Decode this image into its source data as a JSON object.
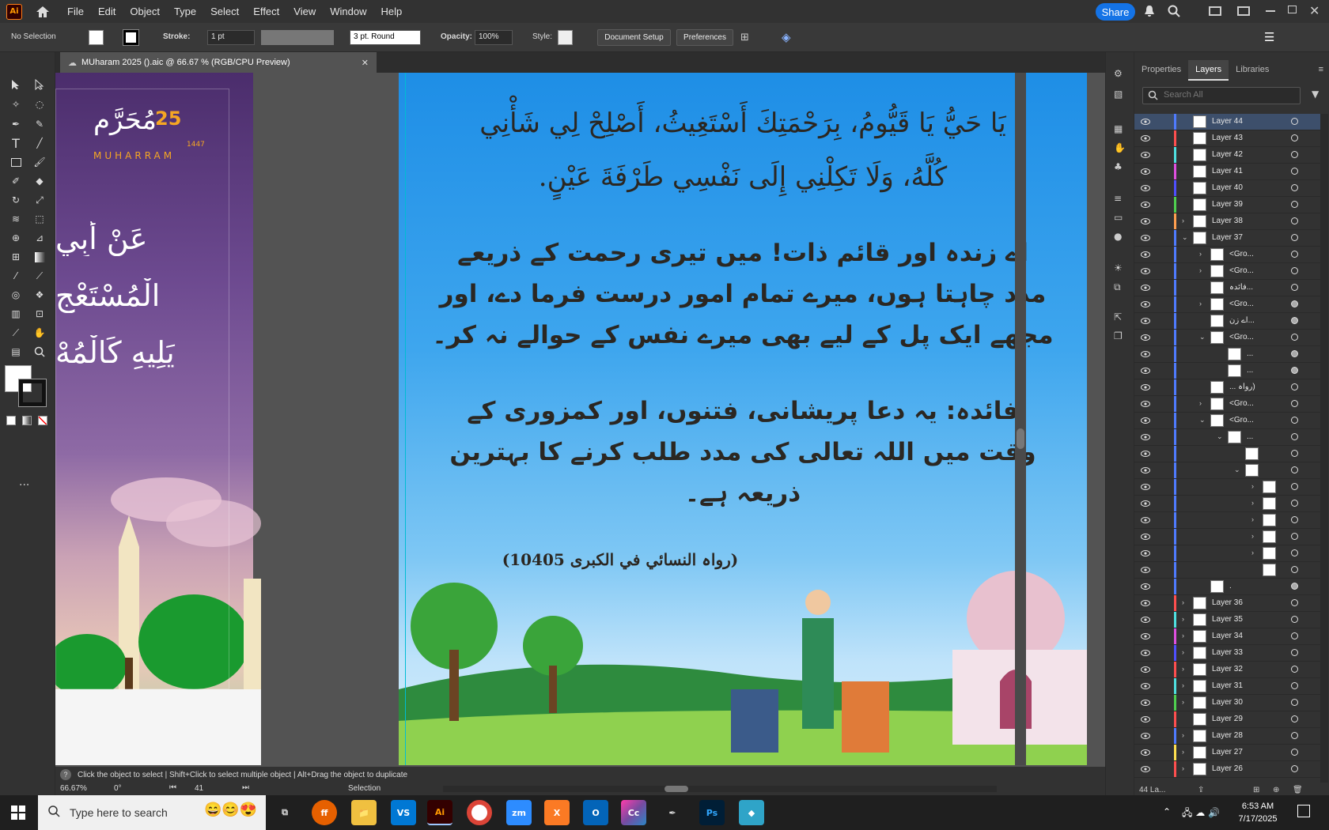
{
  "app": {
    "logo": "Ai",
    "share_label": "Share"
  },
  "menu": [
    "File",
    "Edit",
    "Object",
    "Type",
    "Select",
    "Effect",
    "View",
    "Window",
    "Help"
  ],
  "control": {
    "selection": "No Selection",
    "stroke_label": "Stroke:",
    "stroke_value": "1 pt",
    "brush_value": "3 pt. Round",
    "opacity_label": "Opacity:",
    "opacity_value": "100%",
    "style_label": "Style:",
    "document_setup": "Document Setup",
    "preferences": "Preferences"
  },
  "document": {
    "tab_title": "MUharam 2025 ().aic @ 66.67 % (RGB/CPU Preview)"
  },
  "artboard_left": {
    "date_number": "25",
    "month_arabic": "مُحَرَّم",
    "month_latin": "MUHARRAM",
    "year_small": "1447",
    "line1": "عَنْ أَبِي",
    "line2": "الْمُسْتَعْجِ",
    "line3": "يَلِيهِ كَالْمُهْ"
  },
  "artboard_main": {
    "dua_line1": "يَا حَيُّ يَا قَيُّومُ، بِرَحْمَتِكَ أَسْتَغِيثُ، أَصْلِحْ لِي شَأْنِي",
    "dua_line2": "كُلَّهُ، وَلَا تَكِلْنِي إِلَى نَفْسِي طَرْفَةَ عَيْنٍ.",
    "urdu_line1": "اے زندہ اور قائم ذات! میں تیری رحمت کے ذریعے",
    "urdu_line2": "مدد چاہتا ہوں، میرے تمام امور درست فرما دے، اور",
    "urdu_line3": "مجھے ایک پل کے لیے بھی میرے نفس کے حوالے نہ کر۔",
    "benefit_line1": "فائدہ: یہ دعا پریشانی، فتنوں، اور کمزوری کے",
    "benefit_line2": "وقت میں اللہ تعالی کی مدد طلب کرنے کا بہترین",
    "benefit_line3": "ذریعہ ہے۔",
    "reference": "(رواہ النسائي في الكبرى 10405)"
  },
  "layers_panel": {
    "tabs": [
      "Properties",
      "Layers",
      "Libraries"
    ],
    "active_tab": "Layers",
    "search_placeholder": "Search All",
    "footer_count": "44 La...",
    "rows": [
      {
        "name": "Layer 44",
        "color": "#4f7bff",
        "indent": 0,
        "twirl": "",
        "selected": true,
        "filled": false
      },
      {
        "name": "Layer 43",
        "color": "#ff4f4f",
        "indent": 0,
        "twirl": "",
        "selected": false,
        "filled": false
      },
      {
        "name": "Layer 42",
        "color": "#4fe0e0",
        "indent": 0,
        "twirl": "",
        "selected": false,
        "filled": false
      },
      {
        "name": "Layer 41",
        "color": "#e04fe0",
        "indent": 0,
        "twirl": "",
        "selected": false,
        "filled": false
      },
      {
        "name": "Layer 40",
        "color": "#4f4fff",
        "indent": 0,
        "twirl": "",
        "selected": false,
        "filled": false
      },
      {
        "name": "Layer 39",
        "color": "#4fd04f",
        "indent": 0,
        "twirl": "",
        "selected": false,
        "filled": false
      },
      {
        "name": "Layer 38",
        "color": "#ff9f4f",
        "indent": 0,
        "twirl": "›",
        "selected": false,
        "filled": false
      },
      {
        "name": "Layer 37",
        "color": "#4f7bff",
        "indent": 0,
        "twirl": "⌄",
        "selected": false,
        "filled": false
      },
      {
        "name": "<Gro...",
        "color": "#4f7bff",
        "indent": 1,
        "twirl": "›",
        "selected": false,
        "filled": false
      },
      {
        "name": "<Gro...",
        "color": "#4f7bff",
        "indent": 1,
        "twirl": "›",
        "selected": false,
        "filled": false
      },
      {
        "name": "فائدہ...",
        "color": "#4f7bff",
        "indent": 1,
        "twirl": "",
        "selected": false,
        "filled": false
      },
      {
        "name": "<Gro...",
        "color": "#4f7bff",
        "indent": 1,
        "twirl": "›",
        "selected": false,
        "filled": true
      },
      {
        "name": "اے زن...",
        "color": "#4f7bff",
        "indent": 1,
        "twirl": "",
        "selected": false,
        "filled": true
      },
      {
        "name": "<Gro...",
        "color": "#4f7bff",
        "indent": 1,
        "twirl": "⌄",
        "selected": false,
        "filled": false
      },
      {
        "name": "...",
        "color": "#4f7bff",
        "indent": 2,
        "twirl": "",
        "selected": false,
        "filled": true
      },
      {
        "name": "...",
        "color": "#4f7bff",
        "indent": 2,
        "twirl": "",
        "selected": false,
        "filled": true
      },
      {
        "name": "... رواہ)",
        "color": "#4f7bff",
        "indent": 1,
        "twirl": "",
        "selected": false,
        "filled": false
      },
      {
        "name": "<Gro...",
        "color": "#4f7bff",
        "indent": 1,
        "twirl": "›",
        "selected": false,
        "filled": false
      },
      {
        "name": "<Gro...",
        "color": "#4f7bff",
        "indent": 1,
        "twirl": "⌄",
        "selected": false,
        "filled": false
      },
      {
        "name": "...",
        "color": "#4f7bff",
        "indent": 2,
        "twirl": "⌄",
        "selected": false,
        "filled": false
      },
      {
        "name": "",
        "color": "#4f7bff",
        "indent": 3,
        "twirl": "",
        "selected": false,
        "filled": false
      },
      {
        "name": "",
        "color": "#4f7bff",
        "indent": 3,
        "twirl": "⌄",
        "selected": false,
        "filled": false
      },
      {
        "name": "",
        "color": "#4f7bff",
        "indent": 4,
        "twirl": "›",
        "selected": false,
        "filled": false
      },
      {
        "name": "",
        "color": "#4f7bff",
        "indent": 4,
        "twirl": "›",
        "selected": false,
        "filled": false
      },
      {
        "name": "",
        "color": "#4f7bff",
        "indent": 4,
        "twirl": "›",
        "selected": false,
        "filled": false
      },
      {
        "name": "",
        "color": "#4f7bff",
        "indent": 4,
        "twirl": "›",
        "selected": false,
        "filled": false
      },
      {
        "name": "",
        "color": "#4f7bff",
        "indent": 4,
        "twirl": "›",
        "selected": false,
        "filled": false
      },
      {
        "name": "",
        "color": "#4f7bff",
        "indent": 4,
        "twirl": "",
        "selected": false,
        "filled": false
      },
      {
        "name": ".",
        "color": "#4f7bff",
        "indent": 1,
        "twirl": "",
        "selected": false,
        "filled": true
      },
      {
        "name": "Layer 36",
        "color": "#ff4f4f",
        "indent": 0,
        "twirl": "›",
        "selected": false,
        "filled": false
      },
      {
        "name": "Layer 35",
        "color": "#4fe0e0",
        "indent": 0,
        "twirl": "›",
        "selected": false,
        "filled": false
      },
      {
        "name": "Layer 34",
        "color": "#e04fe0",
        "indent": 0,
        "twirl": "›",
        "selected": false,
        "filled": false
      },
      {
        "name": "Layer 33",
        "color": "#4f4fff",
        "indent": 0,
        "twirl": "›",
        "selected": false,
        "filled": false
      },
      {
        "name": "Layer 32",
        "color": "#ff4f4f",
        "indent": 0,
        "twirl": "›",
        "selected": false,
        "filled": false
      },
      {
        "name": "Layer 31",
        "color": "#4fe0e0",
        "indent": 0,
        "twirl": "›",
        "selected": false,
        "filled": false
      },
      {
        "name": "Layer 30",
        "color": "#4fd04f",
        "indent": 0,
        "twirl": "›",
        "selected": false,
        "filled": false
      },
      {
        "name": "Layer 29",
        "color": "#ff4f4f",
        "indent": 0,
        "twirl": "",
        "selected": false,
        "filled": false
      },
      {
        "name": "Layer 28",
        "color": "#4f7bff",
        "indent": 0,
        "twirl": "›",
        "selected": false,
        "filled": false
      },
      {
        "name": "Layer 27",
        "color": "#ffe04f",
        "indent": 0,
        "twirl": "›",
        "selected": false,
        "filled": false
      },
      {
        "name": "Layer 26",
        "color": "#ff4f4f",
        "indent": 0,
        "twirl": "›",
        "selected": false,
        "filled": false
      }
    ]
  },
  "status": {
    "hint": "Click the object to select  |  Shift+Click to select multiple object  |  Alt+Drag the object to duplicate",
    "zoom": "66.67%",
    "rotation": "0°",
    "artboard": "41",
    "tool": "Selection"
  },
  "taskbar": {
    "search_placeholder": "Type here to search",
    "time": "6:53 AM",
    "date": "7/17/2025"
  }
}
